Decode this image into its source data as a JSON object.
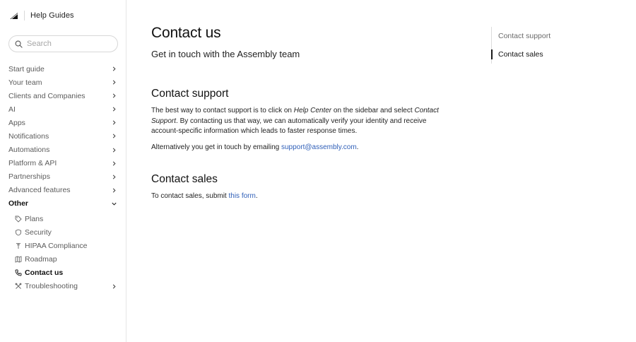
{
  "brand": {
    "title": "Help Guides"
  },
  "search": {
    "placeholder": "Search",
    "value": ""
  },
  "sidebar": {
    "items": [
      {
        "label": "Start guide"
      },
      {
        "label": "Your team"
      },
      {
        "label": "Clients and Companies"
      },
      {
        "label": "AI"
      },
      {
        "label": "Apps"
      },
      {
        "label": "Notifications"
      },
      {
        "label": "Automations"
      },
      {
        "label": "Platform & API"
      },
      {
        "label": "Partnerships"
      },
      {
        "label": "Advanced features"
      },
      {
        "label": "Other"
      }
    ],
    "sub_items": [
      {
        "label": "Plans",
        "icon": "tag-icon"
      },
      {
        "label": "Security",
        "icon": "shield-icon"
      },
      {
        "label": "HIPAA Compliance",
        "icon": "pin-icon"
      },
      {
        "label": "Roadmap",
        "icon": "map-icon"
      },
      {
        "label": "Contact us",
        "icon": "phone-icon"
      },
      {
        "label": "Troubleshooting",
        "icon": "tools-icon"
      }
    ]
  },
  "main": {
    "title": "Contact us",
    "subtitle": "Get in touch with the Assembly team",
    "support": {
      "heading": "Contact support",
      "p1_a": "The best way to contact support is to click on ",
      "p1_em1": "Help Center",
      "p1_b": " on the sidebar and select ",
      "p1_em2": "Contact Support",
      "p1_c": ". By contacting us that way, we can automatically verify your identity and receive account-specific information which leads to faster response times.",
      "p2_a": "Alternatively you get in touch by emailing ",
      "p2_link": "support@assembly.com",
      "p2_b": "."
    },
    "sales": {
      "heading": "Contact sales",
      "p_a": "To contact sales, submit ",
      "p_link": "this form",
      "p_b": "."
    }
  },
  "toc": {
    "items": [
      {
        "label": "Contact support"
      },
      {
        "label": "Contact sales"
      }
    ]
  },
  "colors": {
    "link": "#2f5fb8",
    "text": "#1f1f1f",
    "muted": "#5c5c5c"
  }
}
